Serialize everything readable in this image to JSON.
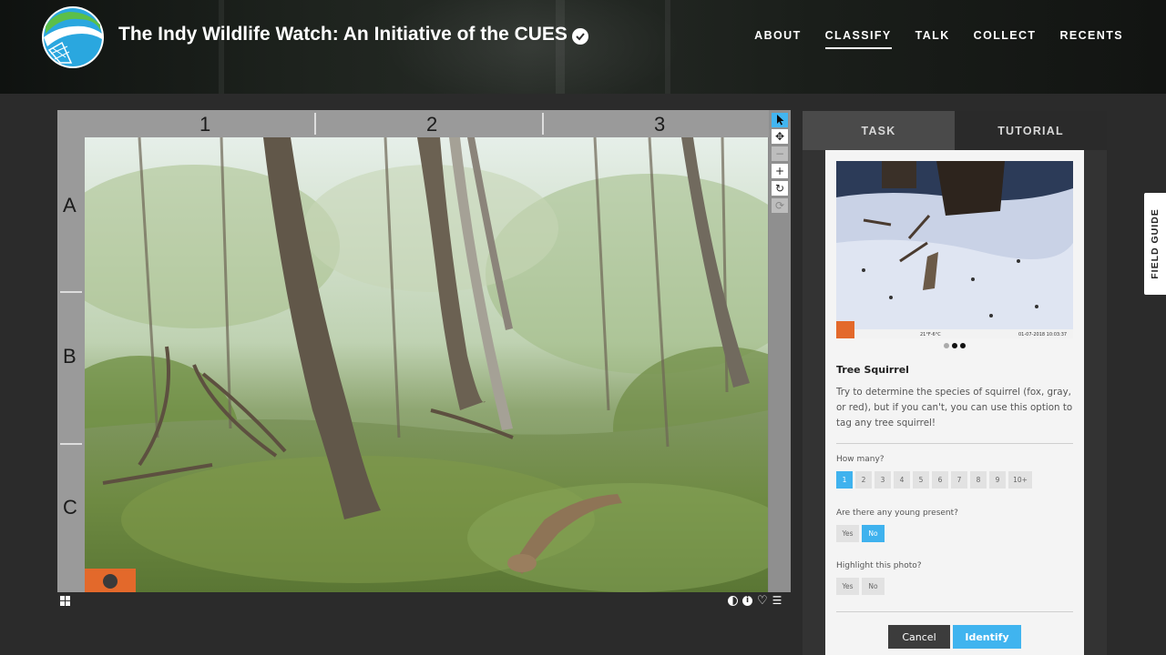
{
  "header": {
    "title": "The Indy Wildlife Watch: An Initiative of the CUES",
    "nav": [
      "ABOUT",
      "CLASSIFY",
      "TALK",
      "COLLECT",
      "RECENTS"
    ],
    "active_nav": "CLASSIFY"
  },
  "viewer": {
    "columns": [
      "1",
      "2",
      "3"
    ],
    "rows": [
      "A",
      "B",
      "C"
    ]
  },
  "panel": {
    "tabs": [
      "TASK",
      "TUTORIAL"
    ],
    "species_name": "Tree Squirrel",
    "description": "Try to determine the species of squirrel (fox, gray, or red), but if you can't, you can use this option to tag any tree squirrel!",
    "example_caption": "21°F-6°C",
    "example_timestamp": "01-07-2018 10:03:37",
    "q_how_many": "How many?",
    "count_options": [
      "1",
      "2",
      "3",
      "4",
      "5",
      "6",
      "7",
      "8",
      "9",
      "10+"
    ],
    "selected_count": "1",
    "q_young": "Are there any young present?",
    "q_highlight": "Highlight this photo?",
    "yes": "Yes",
    "no": "No",
    "young_selected": "No",
    "cancel": "Cancel",
    "identify": "Identify"
  },
  "field_guide": "FIELD GUIDE",
  "colors": {
    "accent": "#42b5f0",
    "panel_bg": "#f4f4f4"
  }
}
